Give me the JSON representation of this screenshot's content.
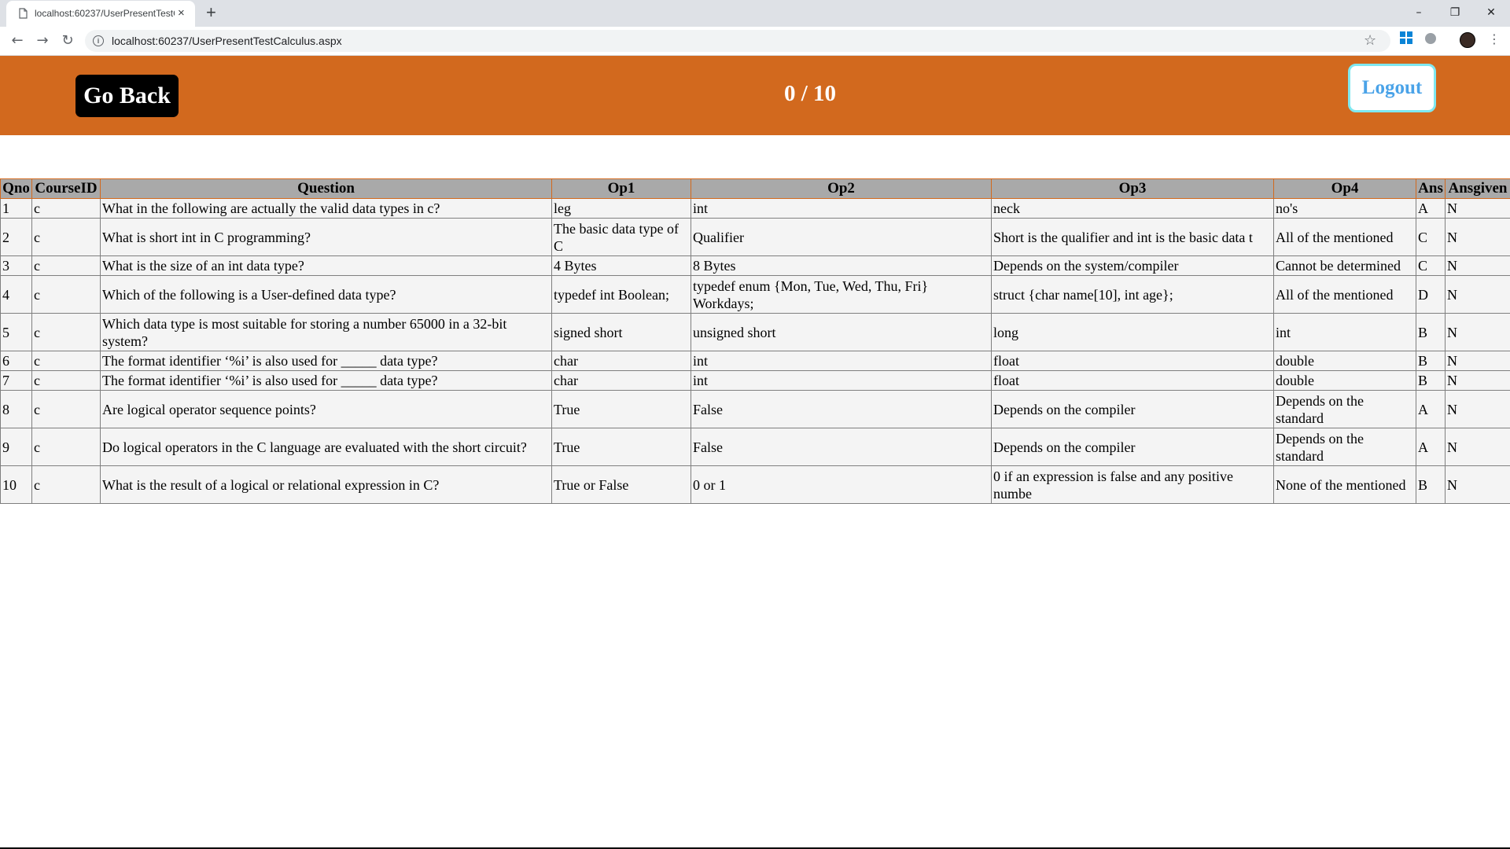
{
  "browser": {
    "tab_title": "localhost:60237/UserPresentTestCalculus.aspx",
    "tab_close": "×",
    "new_tab": "+",
    "url": "localhost:60237/UserPresentTestCalculus.aspx",
    "back": "←",
    "forward": "→",
    "reload": "↻",
    "minimize": "–",
    "restore": "❐",
    "close": "✕",
    "star": "☆",
    "menu": "⋮",
    "info": "i"
  },
  "header": {
    "background": "#d2691e",
    "go_back_label": "Go Back",
    "score": "0 / 10",
    "logout_label": "Logout"
  },
  "table": {
    "header_bg": "#a9a9a9",
    "columns": [
      "Qno",
      "CourseID",
      "Question",
      "Op1",
      "Op2",
      "Op3",
      "Op4",
      "Ans",
      "Ansgiven"
    ],
    "rows": [
      {
        "qno": "1",
        "course": "c",
        "question": "What in the following are actually the valid data types in c?",
        "op1": "leg",
        "op2": "int",
        "op3": "neck",
        "op4": "no's",
        "ans": "A",
        "given": "N"
      },
      {
        "qno": "2",
        "course": "c",
        "question": "What is short int in C programming?",
        "op1": "The basic data type of C",
        "op2": "Qualifier",
        "op3": "Short is the qualifier and int is the basic data t",
        "op4": "All of the mentioned",
        "ans": "C",
        "given": "N"
      },
      {
        "qno": "3",
        "course": "c",
        "question": "What is the size of an int data type?",
        "op1": "4 Bytes",
        "op2": "8 Bytes",
        "op3": "Depends on the system/compiler",
        "op4": "Cannot be determined",
        "ans": "C",
        "given": "N"
      },
      {
        "qno": "4",
        "course": "c",
        "question": "Which of the following is a User-defined data type?",
        "op1": "typedef int Boolean;",
        "op2": "typedef enum {Mon, Tue, Wed, Thu, Fri} Workdays;",
        "op3": "struct {char name[10], int age};",
        "op4": "All of the mentioned",
        "ans": "D",
        "given": "N"
      },
      {
        "qno": "5",
        "course": "c",
        "question": "Which data type is most suitable for storing a number 65000 in a 32-bit system?",
        "op1": "signed short",
        "op2": "unsigned short",
        "op3": "long",
        "op4": "int",
        "ans": "B",
        "given": "N"
      },
      {
        "qno": "6",
        "course": "c",
        "question": "The format identifier ‘%i’ is also used for _____ data type?",
        "op1": "char",
        "op2": "int",
        "op3": "float",
        "op4": "double",
        "ans": "B",
        "given": "N"
      },
      {
        "qno": "7",
        "course": "c",
        "question": "The format identifier ‘%i’ is also used for _____ data type?",
        "op1": "char",
        "op2": "int",
        "op3": "float",
        "op4": "double",
        "ans": "B",
        "given": "N"
      },
      {
        "qno": "8",
        "course": "c",
        "question": "Are logical operator sequence points?",
        "op1": "True",
        "op2": "False",
        "op3": "Depends on the compiler",
        "op4": "Depends on the standard",
        "ans": "A",
        "given": "N"
      },
      {
        "qno": "9",
        "course": "c",
        "question": "Do logical operators in the C language are evaluated with the short circuit?",
        "op1": "True",
        "op2": "False",
        "op3": "Depends on the compiler",
        "op4": "Depends on the standard",
        "ans": "A",
        "given": "N"
      },
      {
        "qno": "10",
        "course": "c",
        "question": "What is the result of a logical or relational expression in C?",
        "op1": "True or False",
        "op2": "0 or 1",
        "op3": "0 if an expression is false and any positive numbe",
        "op4": "None of the mentioned",
        "ans": "B",
        "given": "N"
      }
    ]
  }
}
